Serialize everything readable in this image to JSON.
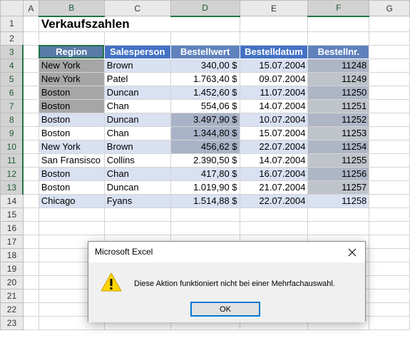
{
  "columns": [
    "A",
    "B",
    "C",
    "D",
    "E",
    "F",
    "G"
  ],
  "rows": [
    "1",
    "2",
    "3",
    "4",
    "5",
    "6",
    "7",
    "8",
    "9",
    "10",
    "11",
    "12",
    "13",
    "14",
    "15",
    "16",
    "17",
    "18",
    "19",
    "20",
    "21",
    "22",
    "23"
  ],
  "title": "Verkaufszahlen",
  "headers": {
    "region": "Region",
    "salesperson": "Salesperson",
    "order_value": "Bestellwert",
    "order_date": "Bestelldatum",
    "order_no": "Bestellnr."
  },
  "data_rows": [
    {
      "region": "New York",
      "salesperson": "Brown",
      "value": "340,00 $",
      "date": "15.07.2004",
      "no": "11248"
    },
    {
      "region": "New York",
      "salesperson": "Patel",
      "value": "1.763,40 $",
      "date": "09.07.2004",
      "no": "11249"
    },
    {
      "region": "Boston",
      "salesperson": "Duncan",
      "value": "1.452,60 $",
      "date": "11.07.2004",
      "no": "11250"
    },
    {
      "region": "Boston",
      "salesperson": "Chan",
      "value": "554,06 $",
      "date": "14.07.2004",
      "no": "11251"
    },
    {
      "region": "Boston",
      "salesperson": "Duncan",
      "value": "3.497,90 $",
      "date": "10.07.2004",
      "no": "11252"
    },
    {
      "region": "Boston",
      "salesperson": "Chan",
      "value": "1.344,80 $",
      "date": "15.07.2004",
      "no": "11253"
    },
    {
      "region": "New York",
      "salesperson": "Brown",
      "value": "456,62 $",
      "date": "22.07.2004",
      "no": "11254"
    },
    {
      "region": "San Fransisco",
      "salesperson": "Collins",
      "value": "2.390,50 $",
      "date": "14.07.2004",
      "no": "11255"
    },
    {
      "region": "Boston",
      "salesperson": "Chan",
      "value": "417,80 $",
      "date": "16.07.2004",
      "no": "11256"
    },
    {
      "region": "Boston",
      "salesperson": "Duncan",
      "value": "1.019,90 $",
      "date": "21.07.2004",
      "no": "11257"
    },
    {
      "region": "Chicago",
      "salesperson": "Fyans",
      "value": "1.514,88 $",
      "date": "22.07.2004",
      "no": "11258"
    }
  ],
  "dialog": {
    "title": "Microsoft Excel",
    "message": "Diese Aktion funktioniert nicht bei einer Mehrfachauswahl.",
    "ok_label": "OK",
    "warning_icon": "warning-icon",
    "close_icon": "close-icon"
  },
  "colors": {
    "header_fill": "#4472c4",
    "band_fill": "#d9e1f2",
    "selection_border": "#217346"
  }
}
